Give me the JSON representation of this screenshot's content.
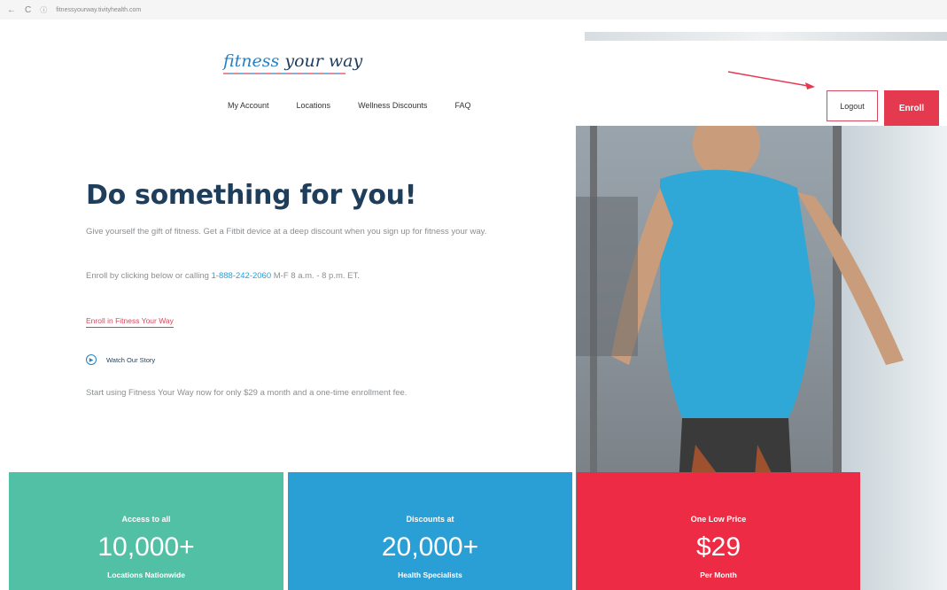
{
  "browser": {
    "back": "←",
    "reload": "C",
    "url": "fitnessyourway.tivityhealth.com"
  },
  "header": {
    "logo_part1": "fitness",
    "logo_part2": "your way",
    "nav": [
      {
        "label": "My Account"
      },
      {
        "label": "Locations"
      },
      {
        "label": "Wellness Discounts"
      },
      {
        "label": "FAQ"
      }
    ],
    "logout_label": "Logout",
    "enroll_label": "Enroll"
  },
  "hero": {
    "title": "Do something for you!",
    "description": "Give yourself the gift of fitness. Get a Fitbit device at a deep discount when you sign up for fitness your way.",
    "enroll_prefix": "Enroll by clicking below or calling",
    "phone": "1-888-242-2060",
    "enroll_suffix": "M-F 8 a.m. - 8 p.m. ET.",
    "enroll_link": "Enroll in Fitness Your Way",
    "watch_story": "Watch Our Story",
    "start_text": "Start using Fitness Your Way now for only $29 a month and a one-time enrollment fee."
  },
  "stats": [
    {
      "top": "Access to all",
      "value": "10,000+",
      "bottom": "Locations Nationwide",
      "color": "#52c0a5"
    },
    {
      "top": "Discounts at",
      "value": "20,000+",
      "bottom": "Health Specialists",
      "color": "#2a9fd6"
    },
    {
      "top": "One Low Price",
      "value": "$29",
      "bottom": "Per Month",
      "color": "#ee2b45"
    }
  ],
  "colors": {
    "navy": "#1e3e5c",
    "accent_red": "#e53950",
    "link_blue": "#2a9fd6"
  }
}
